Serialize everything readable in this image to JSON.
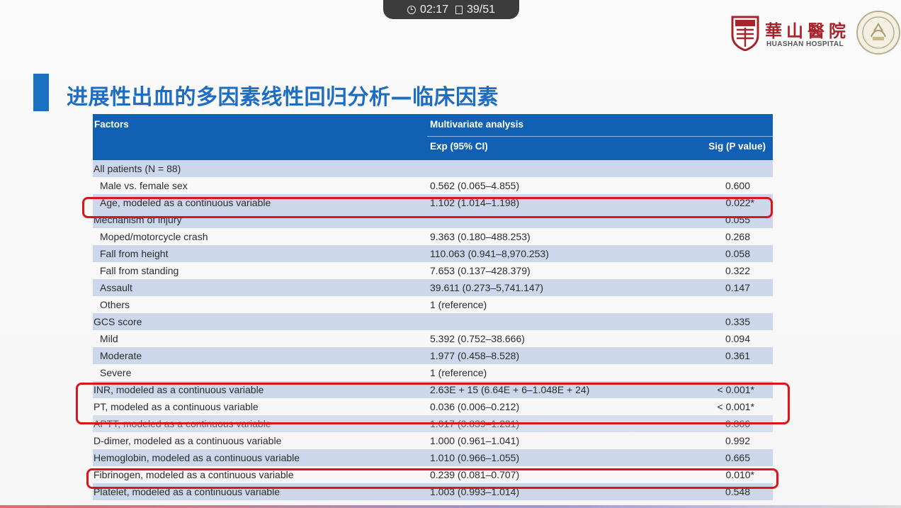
{
  "overlay": {
    "time": "02:17",
    "page_counter": "39/51"
  },
  "logo": {
    "name_cn": "華山醫院",
    "name_en": "HUASHAN HOSPITAL"
  },
  "slide": {
    "title": "进展性出血的多因素线性回归分析—临床因素"
  },
  "colors": {
    "title_blue": "#1e6dc1",
    "header_blue": "#1160b3",
    "row_shade": "#ccd7ec",
    "highlight_red": "#d9161c",
    "logo_red": "#a8232a"
  },
  "table": {
    "header": {
      "factors": "Factors",
      "multivariate": "Multivariate analysis",
      "exp": "Exp (95% CI)",
      "sig": "Sig (P value)"
    },
    "rows": [
      {
        "factor": "All patients (N = 88)",
        "exp": "",
        "sig": ""
      },
      {
        "factor": "Male vs. female sex",
        "exp": "0.562 (0.065–4.855)",
        "sig": "0.600"
      },
      {
        "factor": "Age, modeled as a continuous variable",
        "exp": "1.102 (1.014–1.198)",
        "sig": "0.022*"
      },
      {
        "factor": "Mechanism of injury",
        "exp": "",
        "sig": "0.055"
      },
      {
        "factor": "Moped/motorcycle crash",
        "exp": "9.363 (0.180–488.253)",
        "sig": "0.268"
      },
      {
        "factor": "Fall from height",
        "exp": "110.063 (0.941–8,970.253)",
        "sig": "0.058"
      },
      {
        "factor": "Fall from standing",
        "exp": "7.653 (0.137–428.379)",
        "sig": "0.322"
      },
      {
        "factor": "Assault",
        "exp": "39.611 (0.273–5,741.147)",
        "sig": "0.147"
      },
      {
        "factor": "Others",
        "exp": "1 (reference)",
        "sig": ""
      },
      {
        "factor": "GCS score",
        "exp": "",
        "sig": "0.335"
      },
      {
        "factor": "Mild",
        "exp": "5.392 (0.752–38.666)",
        "sig": "0.094"
      },
      {
        "factor": "Moderate",
        "exp": "1.977 (0.458–8.528)",
        "sig": "0.361"
      },
      {
        "factor": "Severe",
        "exp": "1 (reference)",
        "sig": ""
      },
      {
        "factor": "INR, modeled as a continuous variable",
        "exp": "2.63E + 15 (6.64E + 6–1.048E + 24)",
        "sig": "< 0.001*"
      },
      {
        "factor": "PT, modeled as a continuous variable",
        "exp": "0.036 (0.006–0.212)",
        "sig": "< 0.001*"
      },
      {
        "factor": "APTT, modeled as a continuous variable",
        "exp": "1.017 (0.839–1.231)",
        "sig": "0.866"
      },
      {
        "factor": "D-dimer, modeled as a continuous variable",
        "exp": "1.000 (0.961–1.041)",
        "sig": "0.992"
      },
      {
        "factor": "Hemoglobin, modeled as a continuous variable",
        "exp": "1.010 (0.966–1.055)",
        "sig": "0.665"
      },
      {
        "factor": "Fibrinogen, modeled as a continuous variable",
        "exp": "0.239 (0.081–0.707)",
        "sig": "0.010*"
      },
      {
        "factor": "Platelet, modeled as a continuous variable",
        "exp": "1.003 (0.993–1.014)",
        "sig": "0.548"
      }
    ]
  }
}
